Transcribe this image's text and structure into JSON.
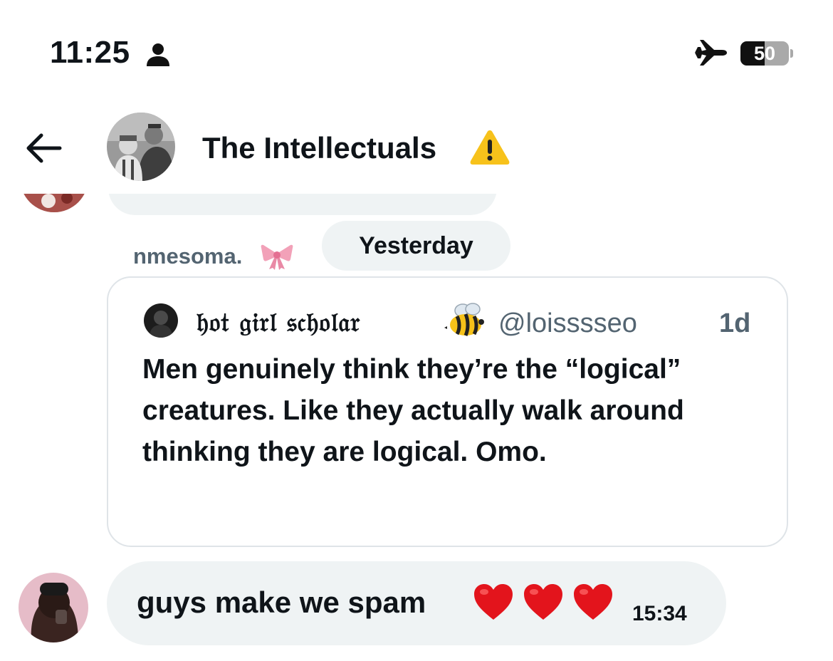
{
  "status_bar": {
    "time": "11:25",
    "battery_percent": "50",
    "battery_level": 0.5,
    "icons": [
      "person-icon",
      "airplane-icon",
      "battery-icon"
    ]
  },
  "header": {
    "back_icon": "arrow-left-icon",
    "title": "The Intellectuals",
    "title_emoji": "warning-icon"
  },
  "conversation": {
    "date_separator": "Yesterday",
    "sender_name": "nmesoma.",
    "sender_emoji": "bow-icon",
    "quoted_tweet": {
      "display_name": "𝔥𝔬𝔱 𝔤𝔦𝔯𝔩 𝔰𝔠𝔥𝔬𝔩𝔞𝔯",
      "name_emoji": "bee-icon",
      "handle": "@loisssseo",
      "time": "1d",
      "text": "Men genuinely think they’re the “logical” creatures. Like they actually walk around thinking they are logical. Omo."
    },
    "message": {
      "text": "guys make we spam",
      "emojis": [
        "heart-icon",
        "heart-icon",
        "heart-icon"
      ],
      "time": "15:34"
    }
  },
  "colors": {
    "text_primary": "#0f1419",
    "text_secondary": "#536471",
    "bubble_background": "#eff3f4",
    "card_border": "#dfe4e8",
    "heart_red": "#e3141c",
    "warning_yellow": "#f7c21b"
  }
}
